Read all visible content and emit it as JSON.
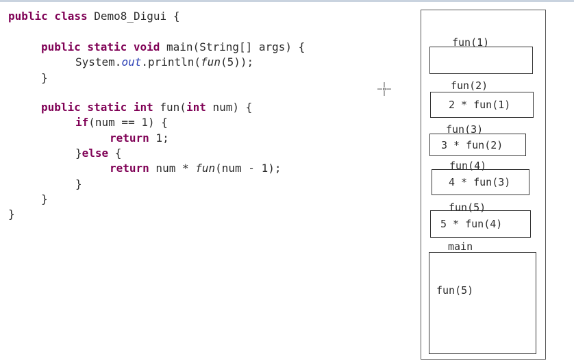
{
  "code": {
    "class_decl": {
      "kw": "public class",
      "name": " Demo8_Digui {"
    },
    "main_sig": {
      "kw": "public static void",
      "rest": " main(String[] args) {"
    },
    "println": {
      "pre": "System.",
      "field": "out",
      "mid": ".println(",
      "fn": "fun",
      "post": "(5));"
    },
    "close_brace_1": "}",
    "fun_sig": {
      "kw1": "public static int",
      "mid": " fun(",
      "kw2": "int",
      "rest": " num) {"
    },
    "if_line": {
      "kw": "if",
      "rest": "(num == 1) {"
    },
    "return1": {
      "kw": "return",
      "rest": " 1;"
    },
    "else_line": {
      "pre": "}",
      "kw": "else",
      "rest": " {"
    },
    "return2": {
      "kw": "return",
      "mid": " num * ",
      "fn": "fun",
      "rest": "(num - 1);"
    },
    "close_brace_2": "}",
    "close_brace_3": "}",
    "close_brace_4": "}"
  },
  "stack": {
    "frames": [
      {
        "label": "fun(1)",
        "content": ""
      },
      {
        "label": "fun(2)",
        "content": "2 * fun(1)"
      },
      {
        "label": "fun(3)",
        "content": "3 * fun(2)"
      },
      {
        "label": "fun(4)",
        "content": "4 * fun(3)"
      },
      {
        "label": "fun(5)",
        "content": "5 * fun(4)"
      },
      {
        "label": "main",
        "content": "fun(5)"
      }
    ]
  }
}
